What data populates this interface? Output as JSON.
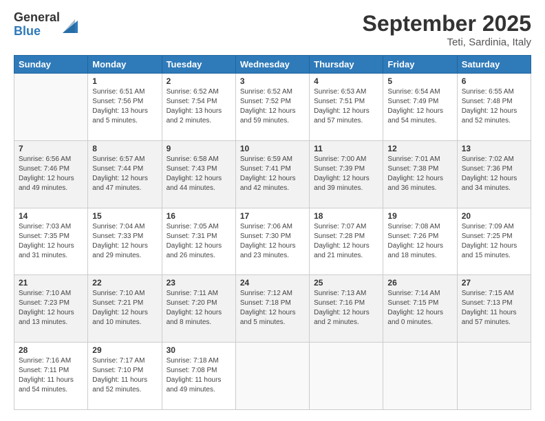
{
  "logo": {
    "general": "General",
    "blue": "Blue"
  },
  "title": "September 2025",
  "subtitle": "Teti, Sardinia, Italy",
  "weekdays": [
    "Sunday",
    "Monday",
    "Tuesday",
    "Wednesday",
    "Thursday",
    "Friday",
    "Saturday"
  ],
  "weeks": [
    [
      {
        "day": "",
        "sunrise": "",
        "sunset": "",
        "daylight": ""
      },
      {
        "day": "1",
        "sunrise": "Sunrise: 6:51 AM",
        "sunset": "Sunset: 7:56 PM",
        "daylight": "Daylight: 13 hours and 5 minutes."
      },
      {
        "day": "2",
        "sunrise": "Sunrise: 6:52 AM",
        "sunset": "Sunset: 7:54 PM",
        "daylight": "Daylight: 13 hours and 2 minutes."
      },
      {
        "day": "3",
        "sunrise": "Sunrise: 6:52 AM",
        "sunset": "Sunset: 7:52 PM",
        "daylight": "Daylight: 12 hours and 59 minutes."
      },
      {
        "day": "4",
        "sunrise": "Sunrise: 6:53 AM",
        "sunset": "Sunset: 7:51 PM",
        "daylight": "Daylight: 12 hours and 57 minutes."
      },
      {
        "day": "5",
        "sunrise": "Sunrise: 6:54 AM",
        "sunset": "Sunset: 7:49 PM",
        "daylight": "Daylight: 12 hours and 54 minutes."
      },
      {
        "day": "6",
        "sunrise": "Sunrise: 6:55 AM",
        "sunset": "Sunset: 7:48 PM",
        "daylight": "Daylight: 12 hours and 52 minutes."
      }
    ],
    [
      {
        "day": "7",
        "sunrise": "Sunrise: 6:56 AM",
        "sunset": "Sunset: 7:46 PM",
        "daylight": "Daylight: 12 hours and 49 minutes."
      },
      {
        "day": "8",
        "sunrise": "Sunrise: 6:57 AM",
        "sunset": "Sunset: 7:44 PM",
        "daylight": "Daylight: 12 hours and 47 minutes."
      },
      {
        "day": "9",
        "sunrise": "Sunrise: 6:58 AM",
        "sunset": "Sunset: 7:43 PM",
        "daylight": "Daylight: 12 hours and 44 minutes."
      },
      {
        "day": "10",
        "sunrise": "Sunrise: 6:59 AM",
        "sunset": "Sunset: 7:41 PM",
        "daylight": "Daylight: 12 hours and 42 minutes."
      },
      {
        "day": "11",
        "sunrise": "Sunrise: 7:00 AM",
        "sunset": "Sunset: 7:39 PM",
        "daylight": "Daylight: 12 hours and 39 minutes."
      },
      {
        "day": "12",
        "sunrise": "Sunrise: 7:01 AM",
        "sunset": "Sunset: 7:38 PM",
        "daylight": "Daylight: 12 hours and 36 minutes."
      },
      {
        "day": "13",
        "sunrise": "Sunrise: 7:02 AM",
        "sunset": "Sunset: 7:36 PM",
        "daylight": "Daylight: 12 hours and 34 minutes."
      }
    ],
    [
      {
        "day": "14",
        "sunrise": "Sunrise: 7:03 AM",
        "sunset": "Sunset: 7:35 PM",
        "daylight": "Daylight: 12 hours and 31 minutes."
      },
      {
        "day": "15",
        "sunrise": "Sunrise: 7:04 AM",
        "sunset": "Sunset: 7:33 PM",
        "daylight": "Daylight: 12 hours and 29 minutes."
      },
      {
        "day": "16",
        "sunrise": "Sunrise: 7:05 AM",
        "sunset": "Sunset: 7:31 PM",
        "daylight": "Daylight: 12 hours and 26 minutes."
      },
      {
        "day": "17",
        "sunrise": "Sunrise: 7:06 AM",
        "sunset": "Sunset: 7:30 PM",
        "daylight": "Daylight: 12 hours and 23 minutes."
      },
      {
        "day": "18",
        "sunrise": "Sunrise: 7:07 AM",
        "sunset": "Sunset: 7:28 PM",
        "daylight": "Daylight: 12 hours and 21 minutes."
      },
      {
        "day": "19",
        "sunrise": "Sunrise: 7:08 AM",
        "sunset": "Sunset: 7:26 PM",
        "daylight": "Daylight: 12 hours and 18 minutes."
      },
      {
        "day": "20",
        "sunrise": "Sunrise: 7:09 AM",
        "sunset": "Sunset: 7:25 PM",
        "daylight": "Daylight: 12 hours and 15 minutes."
      }
    ],
    [
      {
        "day": "21",
        "sunrise": "Sunrise: 7:10 AM",
        "sunset": "Sunset: 7:23 PM",
        "daylight": "Daylight: 12 hours and 13 minutes."
      },
      {
        "day": "22",
        "sunrise": "Sunrise: 7:10 AM",
        "sunset": "Sunset: 7:21 PM",
        "daylight": "Daylight: 12 hours and 10 minutes."
      },
      {
        "day": "23",
        "sunrise": "Sunrise: 7:11 AM",
        "sunset": "Sunset: 7:20 PM",
        "daylight": "Daylight: 12 hours and 8 minutes."
      },
      {
        "day": "24",
        "sunrise": "Sunrise: 7:12 AM",
        "sunset": "Sunset: 7:18 PM",
        "daylight": "Daylight: 12 hours and 5 minutes."
      },
      {
        "day": "25",
        "sunrise": "Sunrise: 7:13 AM",
        "sunset": "Sunset: 7:16 PM",
        "daylight": "Daylight: 12 hours and 2 minutes."
      },
      {
        "day": "26",
        "sunrise": "Sunrise: 7:14 AM",
        "sunset": "Sunset: 7:15 PM",
        "daylight": "Daylight: 12 hours and 0 minutes."
      },
      {
        "day": "27",
        "sunrise": "Sunrise: 7:15 AM",
        "sunset": "Sunset: 7:13 PM",
        "daylight": "Daylight: 11 hours and 57 minutes."
      }
    ],
    [
      {
        "day": "28",
        "sunrise": "Sunrise: 7:16 AM",
        "sunset": "Sunset: 7:11 PM",
        "daylight": "Daylight: 11 hours and 54 minutes."
      },
      {
        "day": "29",
        "sunrise": "Sunrise: 7:17 AM",
        "sunset": "Sunset: 7:10 PM",
        "daylight": "Daylight: 11 hours and 52 minutes."
      },
      {
        "day": "30",
        "sunrise": "Sunrise: 7:18 AM",
        "sunset": "Sunset: 7:08 PM",
        "daylight": "Daylight: 11 hours and 49 minutes."
      },
      {
        "day": "",
        "sunrise": "",
        "sunset": "",
        "daylight": ""
      },
      {
        "day": "",
        "sunrise": "",
        "sunset": "",
        "daylight": ""
      },
      {
        "day": "",
        "sunrise": "",
        "sunset": "",
        "daylight": ""
      },
      {
        "day": "",
        "sunrise": "",
        "sunset": "",
        "daylight": ""
      }
    ]
  ]
}
